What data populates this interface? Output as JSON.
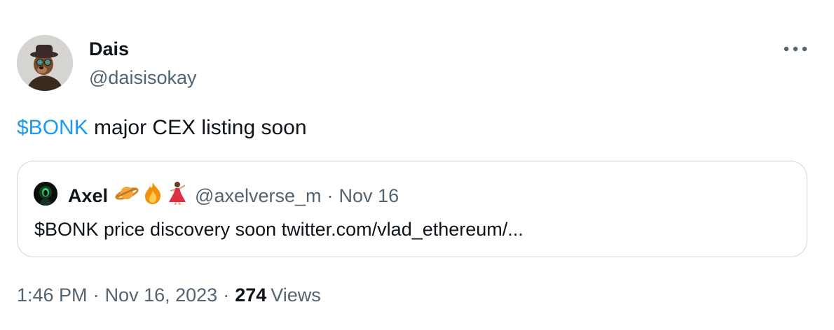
{
  "author": {
    "display_name": "Dais",
    "handle": "@daisisokay",
    "avatar_icon": "bear-avatar-icon"
  },
  "tweet": {
    "cashtag": "$BONK",
    "text_rest": " major CEX listing soon"
  },
  "quote": {
    "display_name": "Axel",
    "emojis": [
      "ringed-planet-emoji",
      "fire-emoji",
      "dancer-emoji"
    ],
    "handle": "@axelverse_m",
    "separator": "·",
    "date": "Nov 16",
    "text": "$BONK price discovery soon twitter.com/vlad_ethereum/..."
  },
  "meta": {
    "time": "1:46 PM",
    "separator": "·",
    "date": "Nov 16, 2023",
    "views_count": "274",
    "views_label": "Views"
  },
  "colors": {
    "link": "#1d9bf0",
    "secondary_text": "#536471",
    "primary_text": "#0f1419",
    "border": "#cfd9de"
  }
}
